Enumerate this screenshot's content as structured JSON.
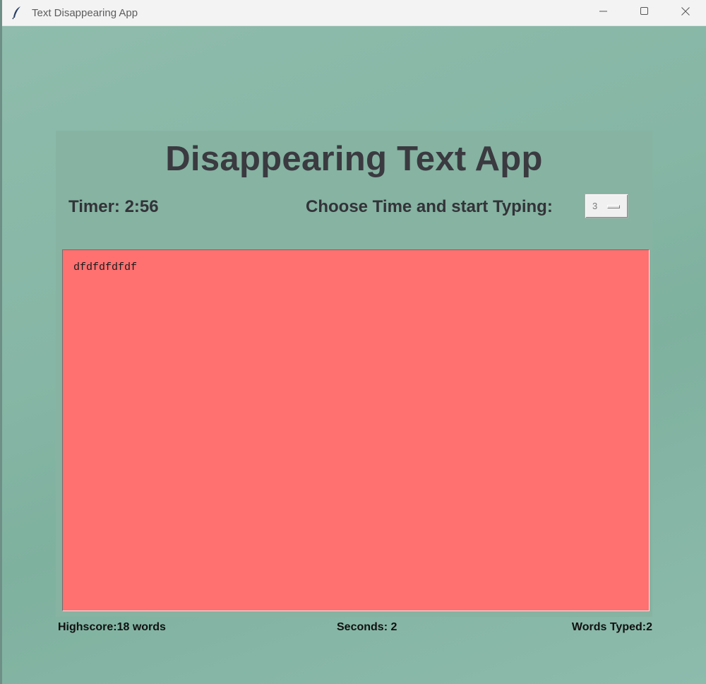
{
  "window": {
    "title": "Text Disappearing App",
    "icons": {
      "app": "feather-icon",
      "minimize": "minimize-icon",
      "maximize": "maximize-icon",
      "close": "close-icon"
    }
  },
  "app": {
    "heading": "Disappearing Text App",
    "timer_label": "Timer: 2:56",
    "choose_label": "Choose Time and start Typing:",
    "time_select": {
      "selected": "3"
    },
    "typed_text": "dfdfdfdfdf",
    "text_area_color": "#ff7070",
    "footer": {
      "highscore": "Highscore:18 words",
      "seconds": "Seconds: 2",
      "words_typed": "Words Typed:2"
    }
  },
  "colors": {
    "background": "#86b3a2",
    "heading": "#3a3a40"
  }
}
